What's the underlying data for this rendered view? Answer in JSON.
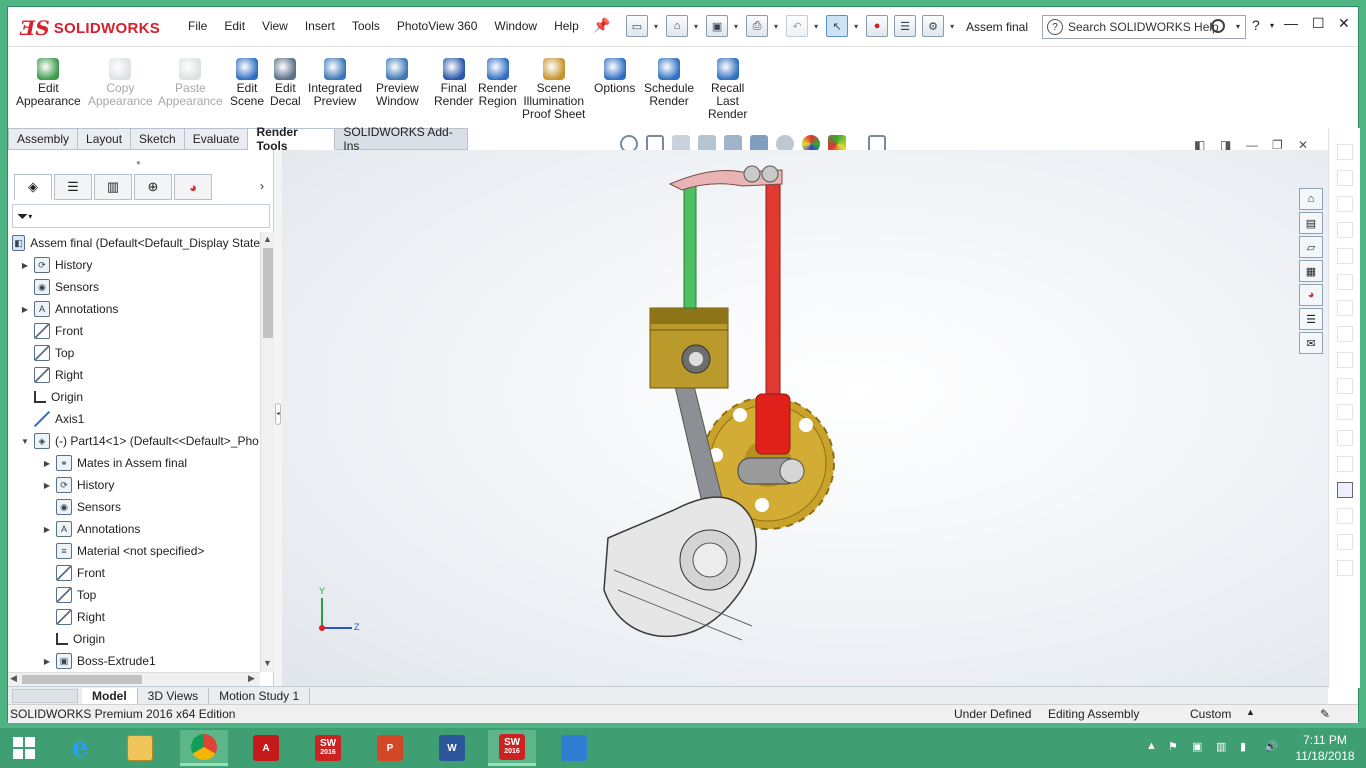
{
  "titlebar": {
    "brand_prefix": "3S",
    "brand": "SOLIDWORKS",
    "menu": [
      "File",
      "Edit",
      "View",
      "Insert",
      "Tools",
      "PhotoView 360",
      "Window",
      "Help"
    ],
    "document_name": "Assem final",
    "search_placeholder": "Search SOLIDWORKS Help",
    "help_glyph": "?"
  },
  "commands": [
    {
      "label": "Edit\nAppearance",
      "icon": "edit-appearance-icon",
      "enabled": true
    },
    {
      "label": "Copy\nAppearance",
      "icon": "copy-appearance-icon",
      "enabled": false
    },
    {
      "label": "Paste\nAppearance",
      "icon": "paste-appearance-icon",
      "enabled": false
    },
    {
      "label": "Edit\nScene",
      "icon": "edit-scene-icon",
      "enabled": true
    },
    {
      "label": "Edit\nDecal",
      "icon": "edit-decal-icon",
      "enabled": true
    },
    {
      "label": "Integrated\nPreview",
      "icon": "integrated-preview-icon",
      "enabled": true
    },
    {
      "label": "Preview\nWindow",
      "icon": "preview-window-icon",
      "enabled": true
    },
    {
      "label": "Final\nRender",
      "icon": "final-render-icon",
      "enabled": true
    },
    {
      "label": "Render\nRegion",
      "icon": "render-region-icon",
      "enabled": true
    },
    {
      "label": "Scene\nIllumination\nProof Sheet",
      "icon": "scene-illumination-icon",
      "enabled": true
    },
    {
      "label": "Options",
      "icon": "options-icon",
      "enabled": true
    },
    {
      "label": "Schedule\nRender",
      "icon": "schedule-render-icon",
      "enabled": true
    },
    {
      "label": "Recall\nLast\nRender",
      "icon": "recall-last-render-icon",
      "enabled": true
    }
  ],
  "tabs": [
    "Assembly",
    "Layout",
    "Sketch",
    "Evaluate",
    "Render Tools",
    "SOLIDWORKS Add-Ins"
  ],
  "active_tab": "Render Tools",
  "feature_tree": {
    "root": "Assem final  (Default<Default_Display State",
    "items": [
      {
        "label": "History",
        "icon": "history",
        "expand": true,
        "indent": 0
      },
      {
        "label": "Sensors",
        "icon": "sensors",
        "expand": false,
        "indent": 0
      },
      {
        "label": "Annotations",
        "icon": "annotations",
        "expand": true,
        "indent": 0
      },
      {
        "label": "Front",
        "icon": "plane",
        "expand": false,
        "indent": 0
      },
      {
        "label": "Top",
        "icon": "plane",
        "expand": false,
        "indent": 0
      },
      {
        "label": "Right",
        "icon": "plane",
        "expand": false,
        "indent": 0
      },
      {
        "label": "Origin",
        "icon": "origin",
        "expand": false,
        "indent": 0
      },
      {
        "label": "Axis1",
        "icon": "axis",
        "expand": false,
        "indent": 0
      },
      {
        "label": "(-) Part14<1> (Default<<Default>_Pho",
        "icon": "part",
        "expand": "open",
        "indent": 0
      },
      {
        "label": "Mates in Assem final",
        "icon": "mates",
        "expand": true,
        "indent": 1
      },
      {
        "label": "History",
        "icon": "history",
        "expand": true,
        "indent": 1
      },
      {
        "label": "Sensors",
        "icon": "sensors",
        "expand": false,
        "indent": 1
      },
      {
        "label": "Annotations",
        "icon": "annotations",
        "expand": true,
        "indent": 1
      },
      {
        "label": "Material <not specified>",
        "icon": "material",
        "expand": false,
        "indent": 1
      },
      {
        "label": "Front",
        "icon": "plane",
        "expand": false,
        "indent": 1
      },
      {
        "label": "Top",
        "icon": "plane",
        "expand": false,
        "indent": 1
      },
      {
        "label": "Right",
        "icon": "plane",
        "expand": false,
        "indent": 1
      },
      {
        "label": "Origin",
        "icon": "origin",
        "expand": false,
        "indent": 1
      },
      {
        "label": "Boss-Extrude1",
        "icon": "extrude",
        "expand": true,
        "indent": 1
      }
    ]
  },
  "triad": {
    "y": "Y",
    "z": "Z"
  },
  "bottom_tabs": [
    "Model",
    "3D Views",
    "Motion Study 1"
  ],
  "active_bottom_tab": "Model",
  "status": {
    "edition": "SOLIDWORKS Premium 2016 x64 Edition",
    "definition": "Under Defined",
    "mode": "Editing Assembly",
    "units": "Custom"
  },
  "taskbar": {
    "sw_badge": "2016",
    "time": "7:11 PM",
    "date": "11/18/2018"
  },
  "colors": {
    "brand_red": "#d8202c",
    "window_frame": "#4fb584",
    "taskbar": "#3f9e72"
  }
}
